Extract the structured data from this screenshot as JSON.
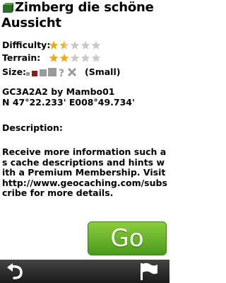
{
  "cache": {
    "title_line1": "Zimberg die schöne",
    "title_line2": "Aussicht",
    "difficulty_label": "Difficulty:",
    "difficulty_rating": 1.5,
    "terrain_label": "Terrain:",
    "terrain_rating": 2,
    "max_rating": 5,
    "size_label": "Size:",
    "size_value": "(Small)",
    "code_owner": "GC3A2A2 by Mambo01",
    "coordinates": "N 47°22.233' E008°49.734'",
    "description_label": "Description:",
    "description_text": "Receive more information such as cache descriptions and hints with a Premium Membership. Visit http://www.geocaching.com/subscribe for more details."
  },
  "actions": {
    "go_label": "Go"
  },
  "icons": {
    "title": "cache-box-icon",
    "star_full": "star-icon",
    "back": "back-arrow-icon",
    "flag": "flag-icon"
  },
  "colors": {
    "star_filled": "#f2a81d",
    "star_empty": "#c8c8c8",
    "go_button": "#6cb52c",
    "bottom_bar": "#2a2a2a",
    "size_selected": "#8b1a1a"
  }
}
